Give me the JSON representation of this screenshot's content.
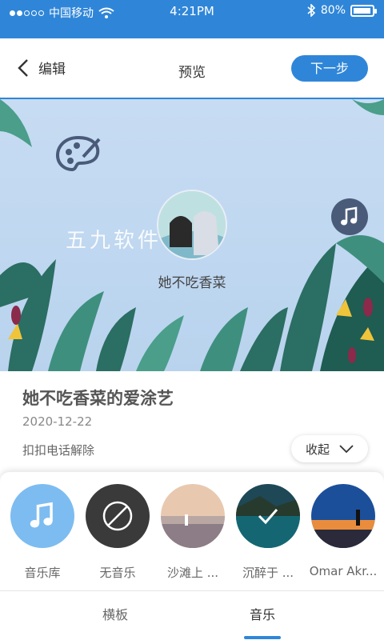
{
  "status_bar": {
    "carrier": "中国移动",
    "time": "4:21PM",
    "battery": "80%"
  },
  "nav": {
    "back_label": "编辑",
    "title": "预览",
    "next_label": "下一步"
  },
  "banner": {
    "name": "她不吃香菜",
    "watermark": "五九软件"
  },
  "info": {
    "title": "她不吃香菜的爱涂艺",
    "date": "2020-12-22",
    "desc": "扣扣电话解除",
    "collapse_label": "收起"
  },
  "music_items": [
    {
      "label": "音乐库",
      "icon": "music-note-icon"
    },
    {
      "label": "无音乐",
      "icon": "no-music-icon"
    },
    {
      "label": "沙滩上 ..."
    },
    {
      "label": "沉醉于 ...",
      "selected": true
    },
    {
      "label": "Omar Akr..."
    }
  ],
  "tabs": [
    {
      "label": "横板"
    },
    {
      "label": "音乐",
      "active": true
    }
  ],
  "colors": {
    "accent": "#2f86d8",
    "music_lib": "#7dbcf0",
    "no_music": "#3a3a3a"
  }
}
